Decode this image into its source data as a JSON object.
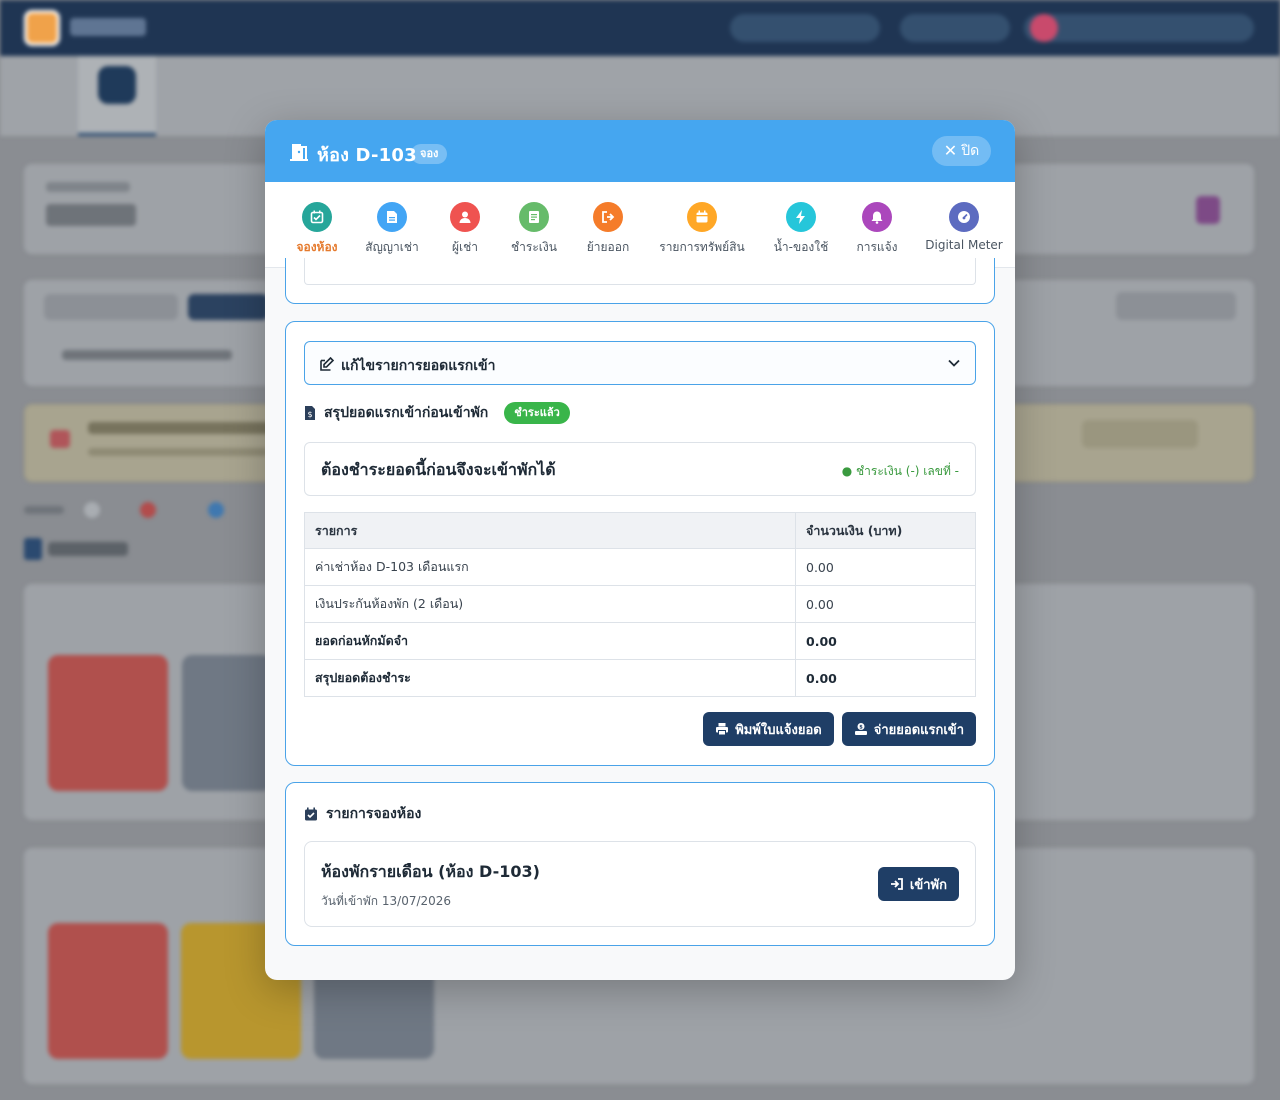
{
  "colors": {
    "header": "#45a6f0",
    "accent_tab": "#e57a2d",
    "dark_button": "#1f3e66",
    "paid": "#39b54a",
    "panel_border": "#4aa3e8"
  },
  "modal": {
    "title": "ห้อง D-103",
    "badge": "จอง",
    "close_label": "ปิด",
    "title_icon": "door-icon",
    "close_icon": "close-icon"
  },
  "tabs": [
    {
      "label": "จองห้อง",
      "icon": "calendar-check-icon",
      "color": "#26a69a",
      "active": true
    },
    {
      "label": "สัญญาเช่า",
      "icon": "document-icon",
      "color": "#42a5f5",
      "active": false
    },
    {
      "label": "ผู้เช่า",
      "icon": "user-icon",
      "color": "#ef5350",
      "active": false
    },
    {
      "label": "ชำระเงิน",
      "icon": "receipt-icon",
      "color": "#66bb6a",
      "active": false
    },
    {
      "label": "ย้ายออก",
      "icon": "sign-out-icon",
      "color": "#f57c2a",
      "active": false
    },
    {
      "label": "รายการทรัพย์สิน",
      "icon": "inventory-icon",
      "color": "#ffa726",
      "active": false
    },
    {
      "label": "น้ำ-ของใช้",
      "icon": "bolt-icon",
      "color": "#26c6da",
      "active": false
    },
    {
      "label": "การแจ้ง",
      "icon": "bell-icon",
      "color": "#ab47bc",
      "active": false
    },
    {
      "label": "Digital Meter",
      "icon": "gauge-icon",
      "color": "#5c6bc0",
      "active": false
    }
  ],
  "deposit": {
    "accordion_label": "แก้ไขรายการยอดแรกเข้า",
    "summary_title": "สรุปยอดแรกเข้าก่อนเข้าพัก",
    "paid_badge": "ชำระแล้ว",
    "notice": "ต้องชำระยอดนี้ก่อนจึงจะเข้าพักได้",
    "payment_status": "● ชำระเงิน (-) เลขที่ -",
    "table": {
      "headers": [
        "รายการ",
        "จำนวนเงิน (บาท)"
      ],
      "rows": [
        {
          "item": "ค่าเช่าห้อง D-103 เดือนแรก",
          "amount": "0.00",
          "bold": false
        },
        {
          "item": "เงินประกันห้องพัก (2 เดือน)",
          "amount": "0.00",
          "bold": false
        },
        {
          "item": "ยอดก่อนหักมัดจำ",
          "amount": "0.00",
          "bold": true
        },
        {
          "item": "สรุปยอดต้องชำระ",
          "amount": "0.00",
          "bold": true
        }
      ]
    },
    "print_button": "พิมพ์ใบแจ้งยอด",
    "pay_button": "จ่ายยอดแรกเข้า"
  },
  "booking": {
    "section_title": "รายการจองห้อง",
    "room_name": "ห้องพักรายเดือน (ห้อง D-103)",
    "checkin_date": "วันที่เข้าพัก 13/07/2026",
    "checkin_button": "เข้าพัก"
  }
}
